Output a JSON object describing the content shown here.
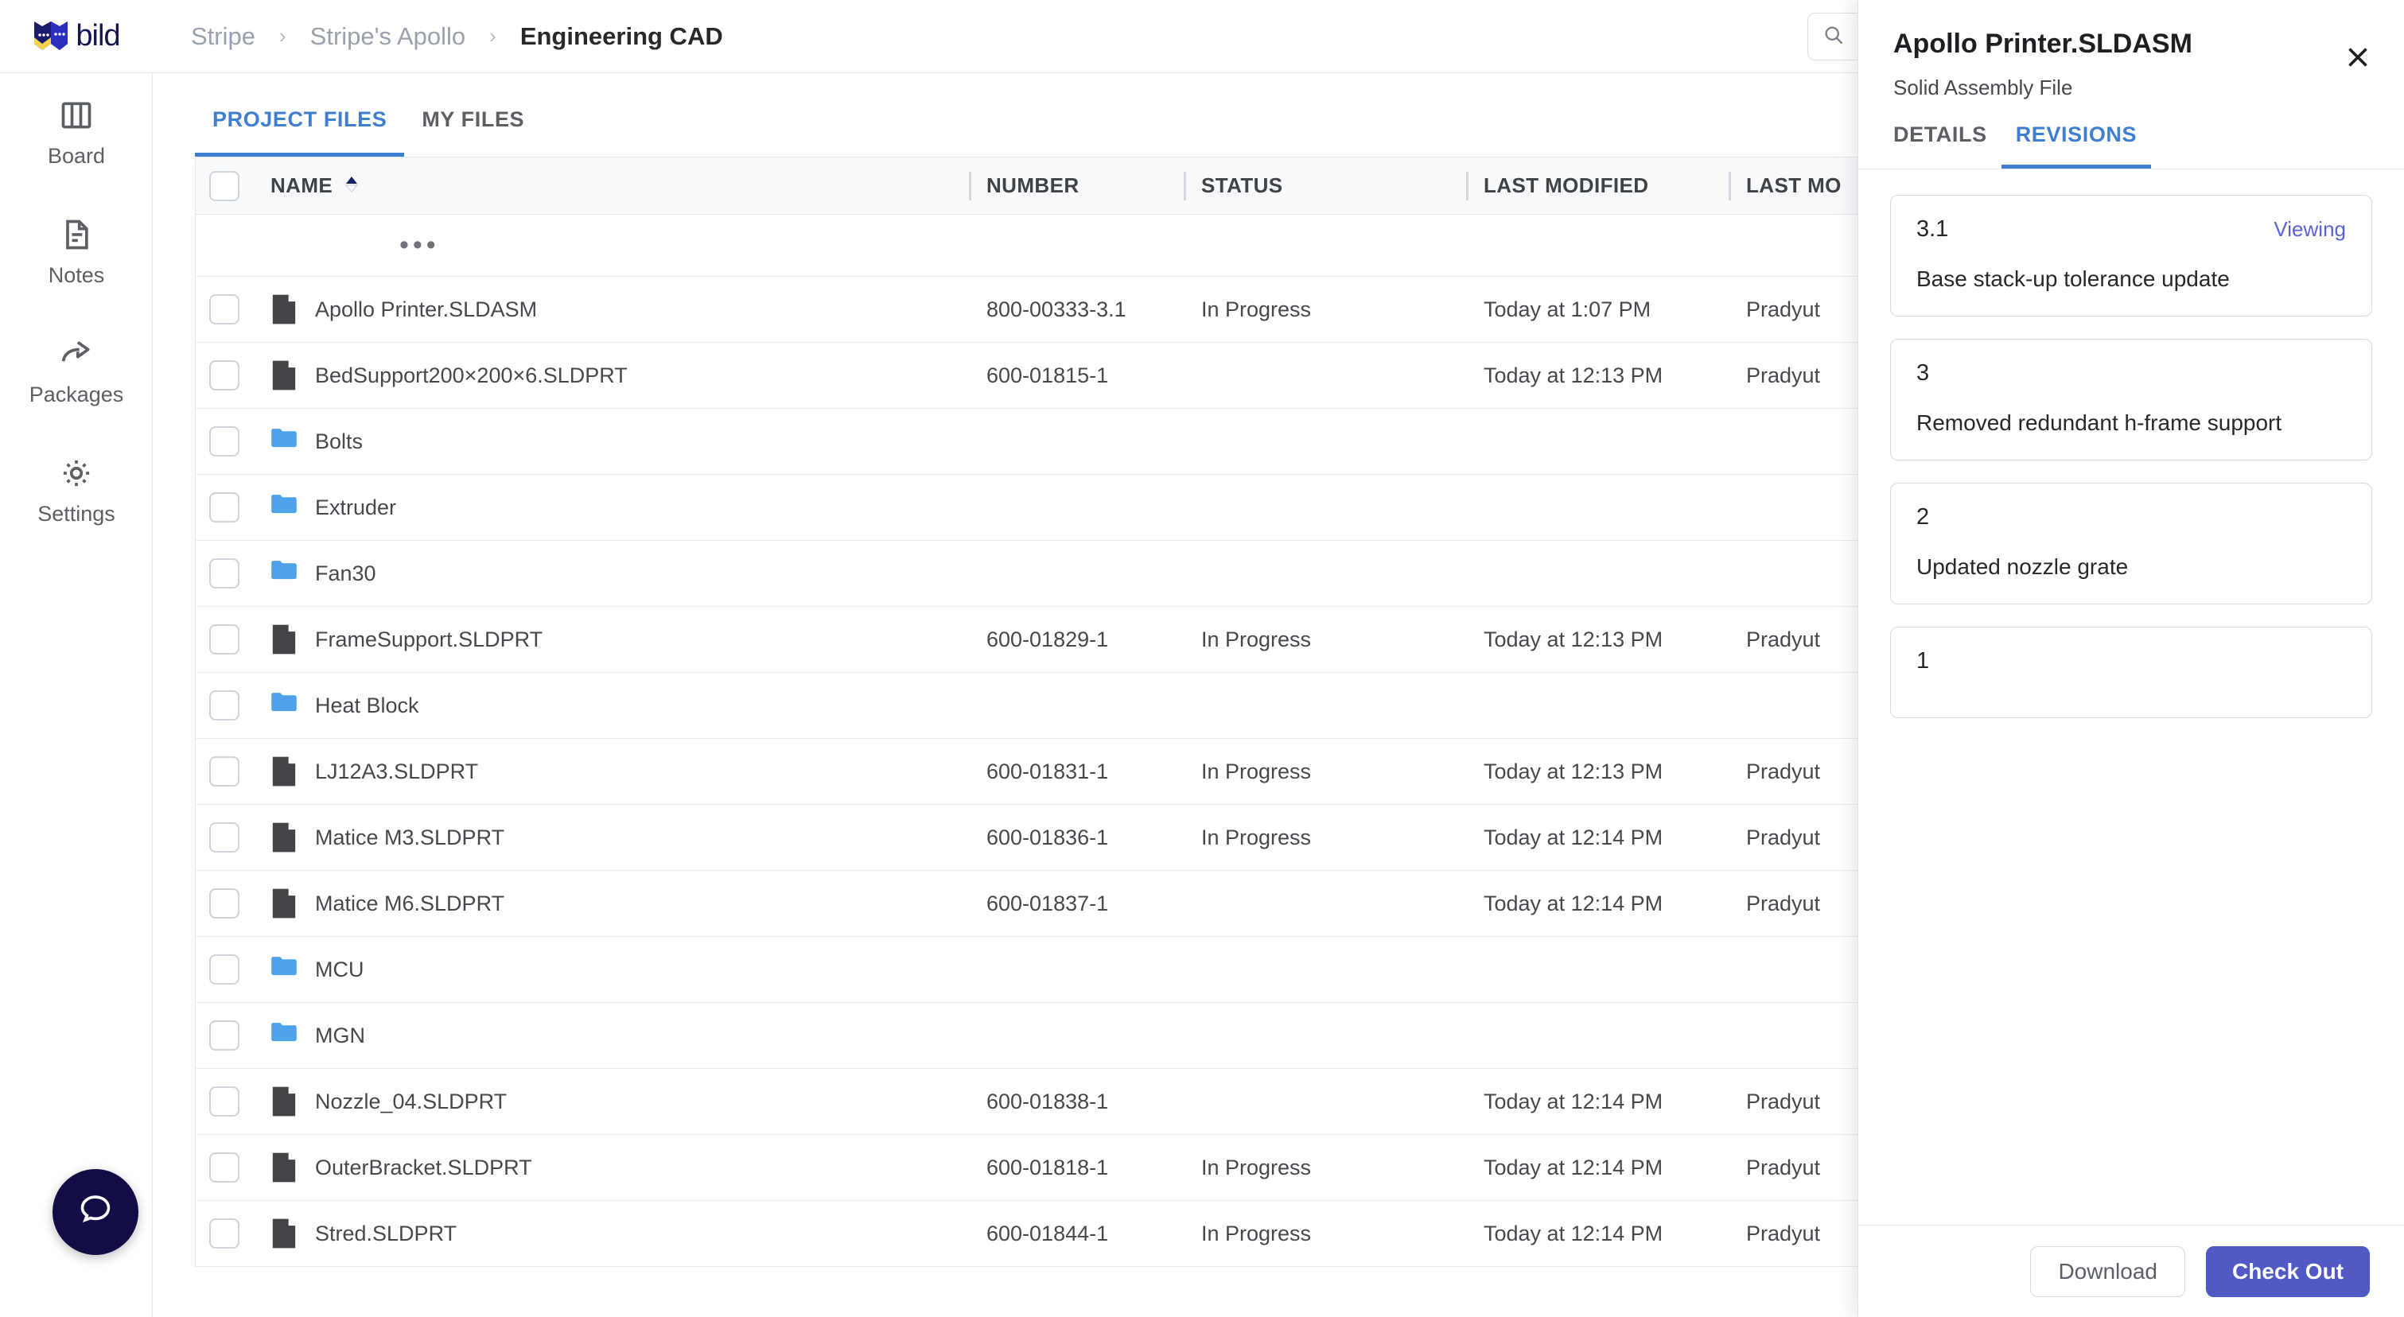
{
  "brand": {
    "name": "bild",
    "logo_icon": "bild-logo-icon",
    "navy": "#120d47",
    "yellow": "#f5d14e",
    "blue": "#2b2fbe"
  },
  "header": {
    "breadcrumb": [
      {
        "label": "Stripe",
        "active": false
      },
      {
        "label": "Stripe's Apollo",
        "active": false
      },
      {
        "label": "Engineering CAD",
        "active": true
      }
    ],
    "separator": "›",
    "search": {
      "icon": "search-icon",
      "value": "",
      "placeholder": ""
    }
  },
  "sidebar": {
    "items": [
      {
        "label": "Board",
        "icon": "columns-icon"
      },
      {
        "label": "Notes",
        "icon": "document-icon"
      },
      {
        "label": "Packages",
        "icon": "share-arrow-icon"
      },
      {
        "label": "Settings",
        "icon": "gear-icon"
      }
    ],
    "help": {
      "icon": "chat-bubble-icon"
    }
  },
  "main": {
    "tabs": [
      {
        "label": "PROJECT FILES",
        "active": true
      },
      {
        "label": "MY FILES",
        "active": false
      }
    ],
    "accent": "#3f7fd1",
    "table": {
      "select_all": false,
      "columns": [
        {
          "key": "name",
          "label": "NAME",
          "sorted": true,
          "sort_caret": "▲"
        },
        {
          "key": "number",
          "label": "NUMBER"
        },
        {
          "key": "status",
          "label": "STATUS"
        },
        {
          "key": "modified",
          "label": "LAST MODIFIED"
        },
        {
          "key": "modified_by",
          "label": "LAST MO"
        }
      ],
      "overflow_row": {
        "dots": "•••"
      },
      "rows": [
        {
          "type": "file",
          "name": "Apollo Printer.SLDASM",
          "number": "800-00333-3.1",
          "status": "In Progress",
          "modified": "Today at 1:07 PM",
          "modified_by": "Pradyut"
        },
        {
          "type": "file",
          "name": "BedSupport200×200×6.SLDPRT",
          "number": "600-01815-1",
          "status": "",
          "modified": "Today at 12:13 PM",
          "modified_by": "Pradyut"
        },
        {
          "type": "folder",
          "name": "Bolts",
          "number": "",
          "status": "",
          "modified": "",
          "modified_by": ""
        },
        {
          "type": "folder",
          "name": "Extruder",
          "number": "",
          "status": "",
          "modified": "",
          "modified_by": ""
        },
        {
          "type": "folder",
          "name": "Fan30",
          "number": "",
          "status": "",
          "modified": "",
          "modified_by": ""
        },
        {
          "type": "file",
          "name": "FrameSupport.SLDPRT",
          "number": "600-01829-1",
          "status": "In Progress",
          "modified": "Today at 12:13 PM",
          "modified_by": "Pradyut"
        },
        {
          "type": "folder",
          "name": "Heat Block",
          "number": "",
          "status": "",
          "modified": "",
          "modified_by": ""
        },
        {
          "type": "file",
          "name": "LJ12A3.SLDPRT",
          "number": "600-01831-1",
          "status": "In Progress",
          "modified": "Today at 12:13 PM",
          "modified_by": "Pradyut"
        },
        {
          "type": "file",
          "name": "Matice M3.SLDPRT",
          "number": "600-01836-1",
          "status": "In Progress",
          "modified": "Today at 12:14 PM",
          "modified_by": "Pradyut"
        },
        {
          "type": "file",
          "name": "Matice M6.SLDPRT",
          "number": "600-01837-1",
          "status": "",
          "modified": "Today at 12:14 PM",
          "modified_by": "Pradyut"
        },
        {
          "type": "folder",
          "name": "MCU",
          "number": "",
          "status": "",
          "modified": "",
          "modified_by": ""
        },
        {
          "type": "folder",
          "name": "MGN",
          "number": "",
          "status": "",
          "modified": "",
          "modified_by": ""
        },
        {
          "type": "file",
          "name": "Nozzle_04.SLDPRT",
          "number": "600-01838-1",
          "status": "",
          "modified": "Today at 12:14 PM",
          "modified_by": "Pradyut"
        },
        {
          "type": "file",
          "name": "OuterBracket.SLDPRT",
          "number": "600-01818-1",
          "status": "In Progress",
          "modified": "Today at 12:14 PM",
          "modified_by": "Pradyut"
        },
        {
          "type": "file",
          "name": "Stred.SLDPRT",
          "number": "600-01844-1",
          "status": "In Progress",
          "modified": "Today at 12:14 PM",
          "modified_by": "Pradyut"
        }
      ]
    }
  },
  "panel": {
    "title": "Apollo Printer.SLDASM",
    "subtitle": "Solid Assembly File",
    "close_icon": "close-icon",
    "tabs": [
      {
        "label": "DETAILS",
        "active": false
      },
      {
        "label": "REVISIONS",
        "active": true
      }
    ],
    "revisions": [
      {
        "number": "3.1",
        "badge": "Viewing",
        "description": "Base stack-up tolerance update"
      },
      {
        "number": "3",
        "badge": "",
        "description": "Removed redundant h-frame support"
      },
      {
        "number": "2",
        "badge": "",
        "description": "Updated nozzle grate"
      },
      {
        "number": "1",
        "badge": "",
        "description": ""
      }
    ],
    "viewing_color": "#5a63d3",
    "footer": {
      "download_label": "Download",
      "checkout_label": "Check Out",
      "primary_color": "#5059c4"
    }
  }
}
